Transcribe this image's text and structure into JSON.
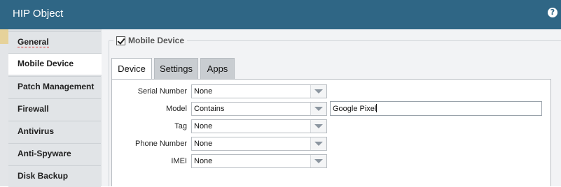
{
  "window": {
    "title": "HIP Object",
    "help_icon": "help-icon"
  },
  "sidebar": {
    "items": [
      {
        "label": "General"
      },
      {
        "label": "Mobile Device",
        "active": true
      },
      {
        "label": "Patch Management"
      },
      {
        "label": "Firewall"
      },
      {
        "label": "Antivirus"
      },
      {
        "label": "Anti-Spyware"
      },
      {
        "label": "Disk Backup"
      }
    ]
  },
  "section": {
    "label": "Mobile Device",
    "checked": true
  },
  "tabs": [
    {
      "label": "Device",
      "active": true
    },
    {
      "label": "Settings"
    },
    {
      "label": "Apps"
    }
  ],
  "fields": [
    {
      "label": "Serial Number",
      "value": "None"
    },
    {
      "label": "Model",
      "value": "Contains",
      "text_value": "Google Pixel"
    },
    {
      "label": "Tag",
      "value": "None"
    },
    {
      "label": "Phone Number",
      "value": "None"
    },
    {
      "label": "IMEI",
      "value": "None"
    }
  ],
  "colors": {
    "titlebar": "#2f6685",
    "sidebar": "#e1e4e7",
    "content": "#f2f3f5"
  }
}
